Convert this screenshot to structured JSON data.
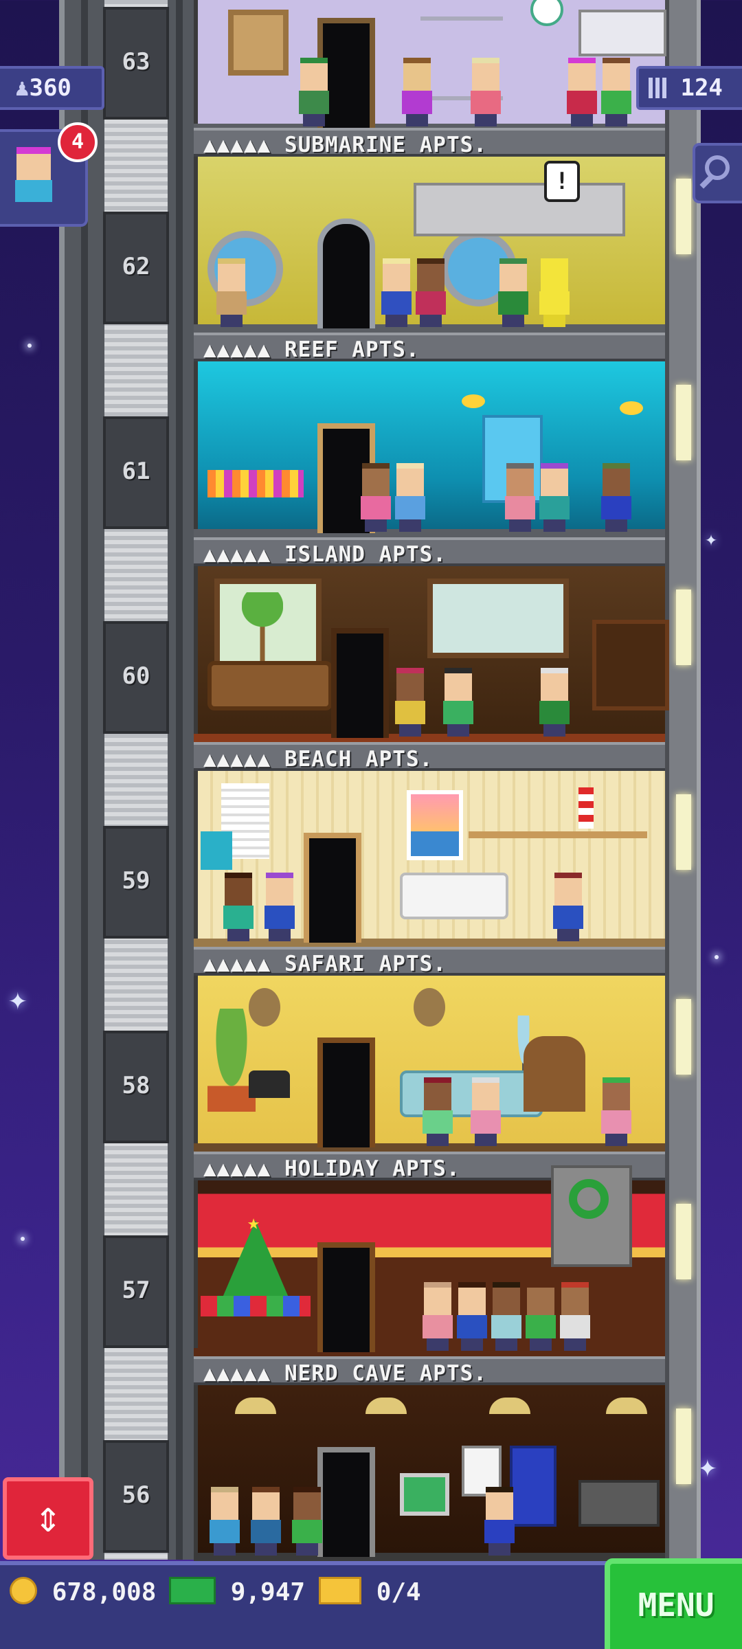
{
  "hud": {
    "population": "360",
    "floors_count": "124",
    "visitor_badge": "4"
  },
  "floors": [
    {
      "number": "63",
      "name": "",
      "theme": "kitchen"
    },
    {
      "number": "62",
      "name": "▲▲▲▲▲ SUBMARINE APTS.",
      "theme": "submarine"
    },
    {
      "number": "61",
      "name": "▲▲▲▲▲ REEF APTS.",
      "theme": "reef"
    },
    {
      "number": "60",
      "name": "▲▲▲▲▲ ISLAND APTS.",
      "theme": "island"
    },
    {
      "number": "59",
      "name": "▲▲▲▲▲ BEACH APTS.",
      "theme": "beach"
    },
    {
      "number": "58",
      "name": "▲▲▲▲▲ SAFARI APTS.",
      "theme": "safari"
    },
    {
      "number": "57",
      "name": "▲▲▲▲▲ HOLIDAY APTS.",
      "theme": "holiday"
    },
    {
      "number": "56",
      "name": "▲▲▲▲▲ NERD CAVE APTS.",
      "theme": "nerdcave"
    }
  ],
  "bottom_bar": {
    "coins": "678,008",
    "bux": "9,947",
    "tickets": "0/4",
    "menu_label": "MENU"
  },
  "icons": {
    "population": "person-icon",
    "floors": "building-icon",
    "search": "magnifier-icon",
    "elevator": "up-down-arrows-icon",
    "coins": "coin-icon",
    "bux": "cash-icon",
    "tickets": "ticket-icon"
  },
  "colors": {
    "accent_red": "#e0253a",
    "menu_green": "#27c13a",
    "hud_blue": "#3b3f86"
  }
}
